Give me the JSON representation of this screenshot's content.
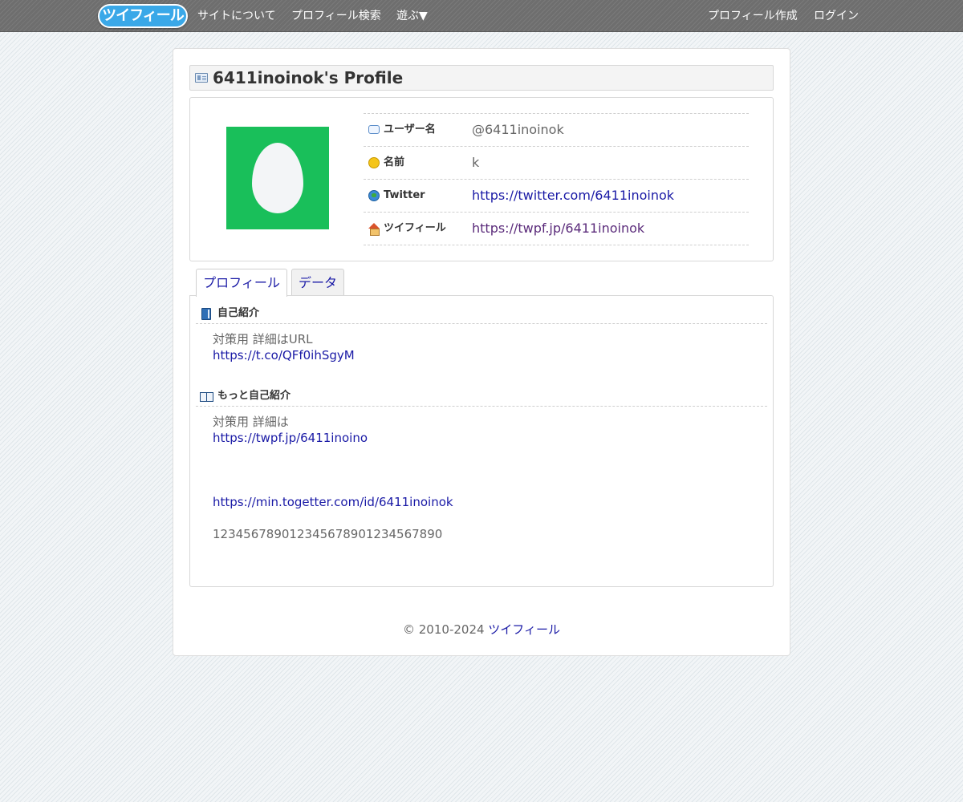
{
  "nav": {
    "logo": "ツイフィール",
    "about": "サイトについて",
    "search": "プロフィール検索",
    "play": "遊ぶ▼",
    "create": "プロフィール作成",
    "login": "ログイン"
  },
  "profile": {
    "title": "6411inoinok's Profile",
    "rows": [
      {
        "label": "ユーザー名",
        "value": "@6411inoinok",
        "icon": "speech-bubble-icon"
      },
      {
        "label": "名前",
        "value": "k",
        "icon": "smiley-face-icon"
      },
      {
        "label": "Twitter",
        "value": "https://twitter.com/6411inoinok",
        "icon": "globe-icon"
      },
      {
        "label": "ツイフィール",
        "value": "https://twpf.jp/6411inoinok",
        "icon": "house-icon"
      }
    ]
  },
  "tabs": {
    "profile": "プロフィール",
    "data": "データ"
  },
  "intro": {
    "title": "自己紹介",
    "line1": "対策用 詳細はURL",
    "line2": "https://t.co/QFf0ihSgyM"
  },
  "more": {
    "title": "もっと自己紹介",
    "line1": "対策用 詳細は",
    "line2": "https://twpf.jp/6411inoino",
    "line3": "https://min.togetter.com/id/6411inoinok",
    "line4": "123456789012345678901234567890"
  },
  "footer": {
    "copyright": "© 2010-2024 ",
    "site": "ツイフィール"
  },
  "colors": {
    "avatar_bg": "#19bf5a",
    "link": "#1a1aa6",
    "visited": "#5a2a7a"
  }
}
